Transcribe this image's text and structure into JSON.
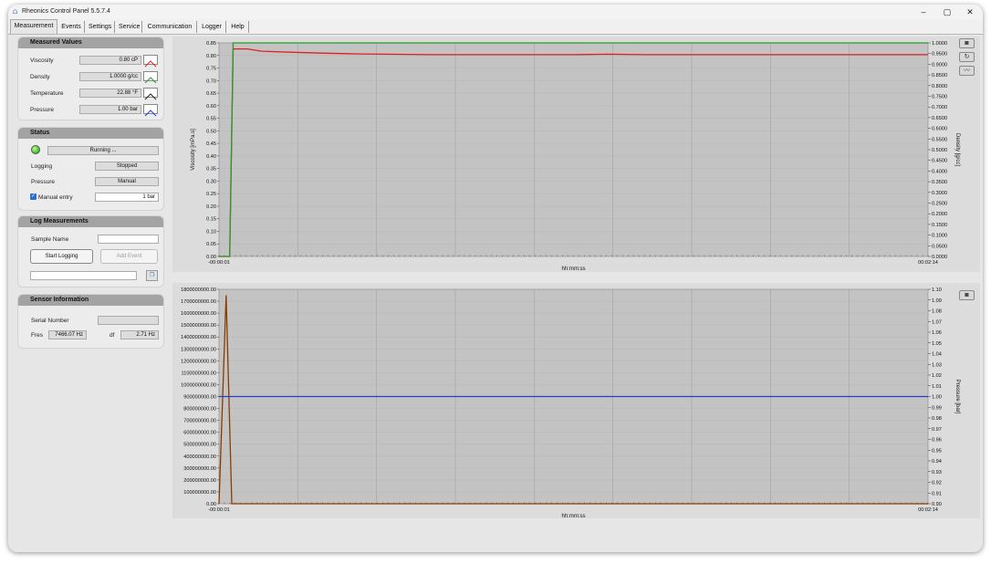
{
  "window": {
    "title": "Rheonics Control Panel 5.5.7.4",
    "controls": {
      "minimize": "–",
      "maximize": "▢",
      "close": "✕"
    }
  },
  "tabs": [
    {
      "label": "Measurement",
      "active": true
    },
    {
      "label": "Events"
    },
    {
      "label": "Settings"
    },
    {
      "label": "Service"
    },
    {
      "label": "Communication"
    },
    {
      "label": "Logger"
    },
    {
      "label": "Help"
    }
  ],
  "measured_values": {
    "title": "Measured Values",
    "rows": [
      {
        "label": "Viscosity",
        "value": "0.80 cP",
        "color": "#e02020"
      },
      {
        "label": "Density",
        "value": "1.0000 g/cc",
        "color": "#2a9a2a"
      },
      {
        "label": "Temperature",
        "value": "22.88 °F",
        "color": "#222222"
      },
      {
        "label": "Pressure",
        "value": "1.00 bar",
        "color": "#2040d0"
      }
    ]
  },
  "status": {
    "title": "Status",
    "running": "Running ...",
    "logging_label": "Logging",
    "logging_value": "Stopped",
    "pressure_label": "Pressure",
    "pressure_value": "Manual",
    "manual_entry_label": "Manual entry",
    "manual_entry_value": "1 bar"
  },
  "log_measurements": {
    "title": "Log Measurements",
    "sample_name_label": "Sample Name",
    "sample_name_value": "",
    "start_logging": "Start Logging",
    "add_event": "Add Event",
    "path_value": ""
  },
  "sensor_info": {
    "title": "Sensor Information",
    "serial_label": "Serial Number",
    "serial_value": "",
    "fres_label": "Fres",
    "fres_value": "7466.07 Hz",
    "df_label": "df",
    "df_value": "2.71 Hz"
  },
  "icons": {
    "camera": "camera-icon",
    "refresh": "refresh-icon",
    "trend": "trend-icon"
  },
  "chart_data": [
    {
      "type": "line",
      "xlabel": "hh:mm:ss",
      "ylabel": "Viscosity [mPa.s]",
      "y2label": "Density [g/cc]",
      "x_tick_labels": [
        "-00:00:01",
        "00:02:14"
      ],
      "ylim": [
        0,
        0.85
      ],
      "y_ticks": [
        "0.00",
        "0.05",
        "0.10",
        "0.15",
        "0.20",
        "0.25",
        "0.30",
        "0.35",
        "0.40",
        "0.45",
        "0.50",
        "0.55",
        "0.60",
        "0.65",
        "0.70",
        "0.75",
        "0.80",
        "0.85"
      ],
      "y2lim": [
        0,
        1.0
      ],
      "y2_ticks": [
        "0.0000",
        "0.0500",
        "0.1000",
        "0.1500",
        "0.2000",
        "0.2500",
        "0.3000",
        "0.3500",
        "0.4000",
        "0.4500",
        "0.5000",
        "0.5500",
        "0.6000",
        "0.6500",
        "0.7000",
        "0.7500",
        "0.8000",
        "0.8500",
        "0.9000",
        "0.9500",
        "1.0000"
      ],
      "grid": true,
      "series": [
        {
          "axis": "left",
          "color": "#e02020",
          "x": [
            0,
            0.015,
            0.02,
            0.04,
            0.06,
            0.1,
            0.15,
            0.2,
            0.3,
            0.5,
            0.55,
            0.6,
            0.8,
            1.0
          ],
          "y": [
            0,
            0,
            0.826,
            0.826,
            0.817,
            0.813,
            0.809,
            0.806,
            0.803,
            0.803,
            0.805,
            0.803,
            0.803,
            0.803
          ]
        },
        {
          "axis": "right",
          "color": "#2a9a2a",
          "x": [
            0,
            0.015,
            0.02,
            1.0
          ],
          "y": [
            0,
            0,
            1.0,
            1.0
          ]
        }
      ]
    },
    {
      "type": "line",
      "xlabel": "hh:mm:ss",
      "ylabel": "",
      "y2label": "Pressure [bar]",
      "x_tick_labels": [
        "-00:00:01",
        "00:02:14"
      ],
      "ylim": [
        0,
        1800000000
      ],
      "y_ticks": [
        "0.00",
        "100000000.00",
        "200000000.00",
        "300000000.00",
        "400000000.00",
        "500000000.00",
        "600000000.00",
        "700000000.00",
        "800000000.00",
        "900000000.00",
        "1000000000.00",
        "1100000000.00",
        "1200000000.00",
        "1300000000.00",
        "1400000000.00",
        "1500000000.00",
        "1600000000.00",
        "1700000000.00",
        "1800000000.00"
      ],
      "y2lim": [
        0.9,
        1.1
      ],
      "y2_ticks": [
        "0.90",
        "0.91",
        "0.92",
        "0.93",
        "0.94",
        "0.95",
        "0.96",
        "0.97",
        "0.98",
        "0.99",
        "1.00",
        "1.01",
        "1.02",
        "1.03",
        "1.04",
        "1.05",
        "1.06",
        "1.07",
        "1.08",
        "1.09",
        "1.10"
      ],
      "grid": true,
      "series": [
        {
          "axis": "left",
          "color": "#8b3a00",
          "x": [
            0,
            0.01,
            0.018,
            1.0
          ],
          "y": [
            0,
            1750000000,
            0,
            0
          ]
        },
        {
          "axis": "right",
          "color": "#2040d0",
          "x": [
            0,
            1.0
          ],
          "y": [
            1.0,
            1.0
          ]
        }
      ]
    }
  ]
}
